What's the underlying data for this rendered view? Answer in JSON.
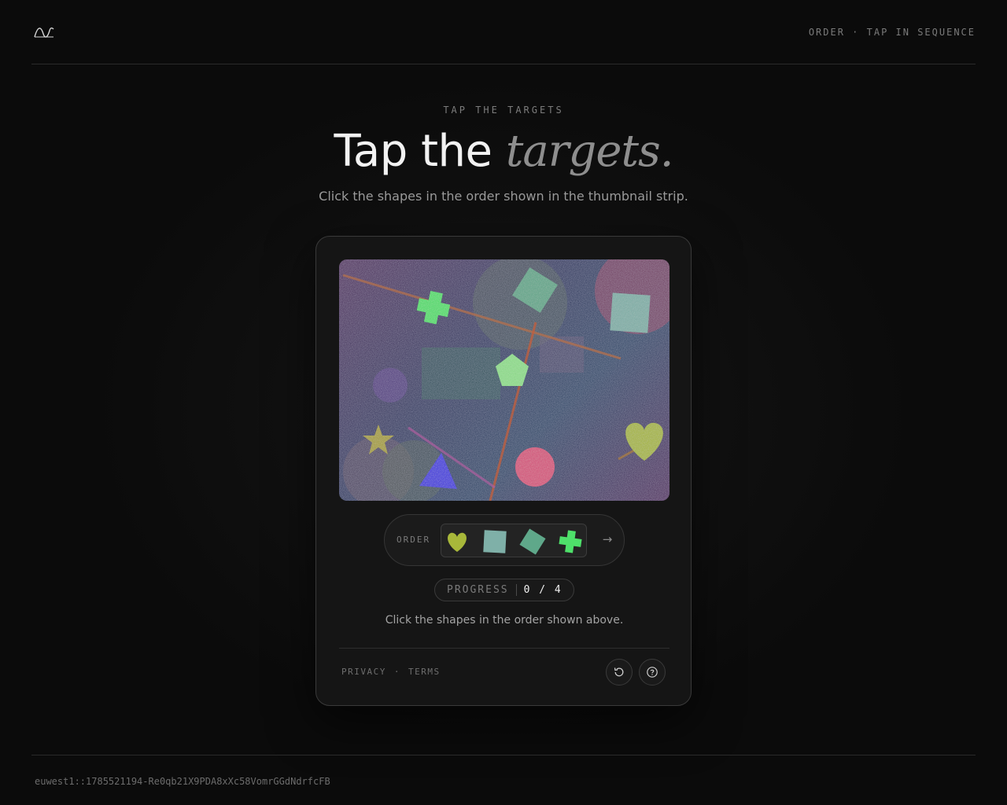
{
  "header": {
    "status": "ORDER · TAP IN SEQUENCE"
  },
  "hero": {
    "eyebrow": "TAP THE TARGETS",
    "title_main": "Tap the",
    "title_accent": "targets.",
    "subtitle": "Click the shapes in the order shown in the thumbnail strip."
  },
  "challenge": {
    "order_label": "ORDER",
    "order_sequence": [
      "heart-olive",
      "square-teal",
      "diamond-teal",
      "cross-green"
    ],
    "progress_label": "PROGRESS",
    "progress_value": "0 / 4",
    "progress_current": 0,
    "progress_total": 4,
    "instruction": "Click the shapes in the order shown above.",
    "links": {
      "privacy": "PRIVACY",
      "separator": "·",
      "terms": "TERMS"
    },
    "icons": {
      "next": "arrow-right-icon",
      "refresh": "refresh-icon",
      "help": "help-icon"
    }
  },
  "colors": {
    "background": "#0b0b0b",
    "card": "#151515",
    "green": "#4ee06a",
    "teal": "#7fb0a8",
    "olive": "#a8b83a",
    "blue": "#3a2fe0",
    "pink": "#d8507a"
  },
  "footer": {
    "request_id": "euwest1::1785521194-Re0qb21X9PDA8xXc58VomrGGdNdrfcFB"
  }
}
